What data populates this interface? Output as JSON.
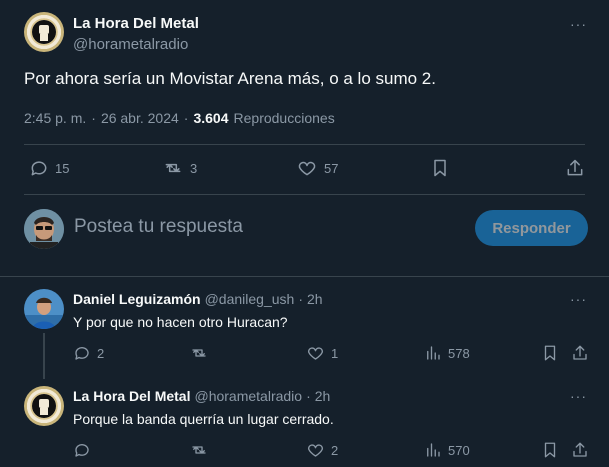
{
  "main_post": {
    "author_name": "La Hora Del Metal",
    "handle": "@horametalradio",
    "text": "Por ahora sería un Movistar Arena más, o a lo sumo 2.",
    "time": "2:45 p. m.",
    "separator": "·",
    "date": "26 abr. 2024",
    "views_count": "3.604",
    "views_label": "Reproducciones",
    "more": "···",
    "actions": {
      "replies": "15",
      "reposts": "3",
      "likes": "57"
    }
  },
  "composer": {
    "placeholder": "Postea tu respuesta",
    "button_label": "Responder"
  },
  "replies": [
    {
      "author_name": "Daniel Leguizamón",
      "handle": "@danileg_ush",
      "separator": "·",
      "time": "2h",
      "text": "Y por que no hacen otro Huracan?",
      "more": "···",
      "actions": {
        "replies": "2",
        "reposts": "",
        "likes": "1",
        "views": "578"
      }
    },
    {
      "author_name": "La Hora Del Metal",
      "handle": "@horametalradio",
      "separator": "·",
      "time": "2h",
      "text": "Porque la banda querría un lugar cerrado.",
      "more": "···",
      "actions": {
        "replies": "",
        "reposts": "",
        "likes": "2",
        "views": "570"
      }
    }
  ],
  "colors": {
    "background": "#15202b",
    "text": "#f7f9f9",
    "muted": "#8b98a5",
    "divider": "#38444d",
    "button": "#1d9bf0"
  }
}
